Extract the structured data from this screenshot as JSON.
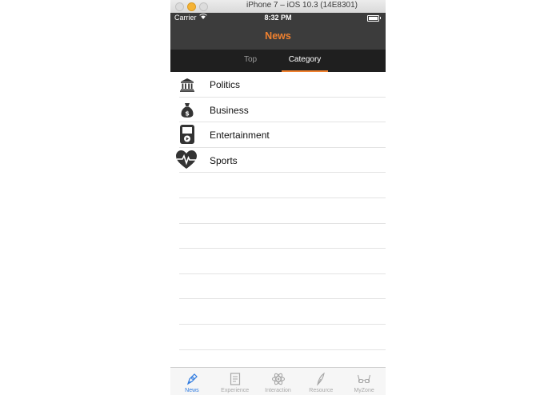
{
  "window": {
    "title": "iPhone 7 – iOS 10.3 (14E8301)"
  },
  "status_bar": {
    "carrier": "Carrier",
    "time": "8:32 PM",
    "wifi_icon": "wifi-icon",
    "battery_icon": "battery-icon"
  },
  "nav": {
    "title": "News",
    "title_color": "#f0812f",
    "bar_color": "#3c3c3c"
  },
  "tabs": [
    {
      "label": "Top",
      "selected": false
    },
    {
      "label": "Category",
      "selected": true
    }
  ],
  "categories": [
    {
      "label": "Politics",
      "icon": "government-building-icon"
    },
    {
      "label": "Business",
      "icon": "money-bag-icon"
    },
    {
      "label": "Entertainment",
      "icon": "media-player-icon"
    },
    {
      "label": "Sports",
      "icon": "heart-pulse-icon"
    }
  ],
  "tab_bar": [
    {
      "label": "News",
      "icon": "compass-pen-icon",
      "selected": true
    },
    {
      "label": "Experience",
      "icon": "document-icon",
      "selected": false
    },
    {
      "label": "Interaction",
      "icon": "atom-icon",
      "selected": false
    },
    {
      "label": "Resource",
      "icon": "quill-icon",
      "selected": false
    },
    {
      "label": "MyZone",
      "icon": "glasses-icon",
      "selected": false
    }
  ],
  "colors": {
    "accent": "#f0812f",
    "tab_active": "#2f7be0",
    "tab_inactive": "#a8a8a8"
  }
}
